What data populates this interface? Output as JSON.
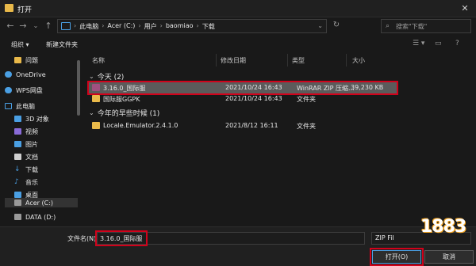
{
  "window": {
    "title": "打开"
  },
  "address": {
    "crumbs": [
      "此电脑",
      "Acer (C:)",
      "用户",
      "baomiao",
      "下载"
    ]
  },
  "search": {
    "placeholder": "搜索\"下载\""
  },
  "command_bar": {
    "organize": "组织 ▾",
    "new_folder": "新建文件夹"
  },
  "sidebar": {
    "items": [
      {
        "label": "问题",
        "icon": "folder-icon",
        "color": "#e9b94a"
      },
      {
        "label": "OneDrive",
        "icon": "cloud-icon",
        "color": "#4a9fe3"
      },
      {
        "label": "WPS网盘",
        "icon": "cloud-icon",
        "color": "#4a9fe3"
      },
      {
        "label": "此电脑",
        "icon": "computer-icon",
        "color": "#4a9fe3"
      },
      {
        "label": "3D 对象",
        "icon": "cube-icon",
        "color": "#4a9fe3"
      },
      {
        "label": "视频",
        "icon": "video-icon",
        "color": "#8a6bd8"
      },
      {
        "label": "图片",
        "icon": "image-icon",
        "color": "#4a9fe3"
      },
      {
        "label": "文档",
        "icon": "document-icon",
        "color": "#d0d0d0"
      },
      {
        "label": "下载",
        "icon": "download-icon",
        "color": "#4a9fe3"
      },
      {
        "label": "音乐",
        "icon": "music-icon",
        "color": "#4a9fe3"
      },
      {
        "label": "桌面",
        "icon": "desktop-icon",
        "color": "#4a9fe3"
      },
      {
        "label": "Acer (C:)",
        "icon": "drive-icon",
        "color": "#9a9a9a"
      },
      {
        "label": "DATA (D:)",
        "icon": "drive-icon",
        "color": "#9a9a9a"
      }
    ]
  },
  "columns": {
    "name": "名称",
    "date": "修改日期",
    "type": "类型",
    "size": "大小"
  },
  "groups": {
    "today": {
      "label": "今天 (2)",
      "files": [
        {
          "name": "3.16.0_国际服",
          "date": "2021/10/24 16:43",
          "type": "WinRAR ZIP 压缩...",
          "size": "39,230 KB",
          "icon": "zip-icon"
        },
        {
          "name": "国际服GGPK",
          "date": "2021/10/24 16:43",
          "type": "文件夹",
          "size": "",
          "icon": "folder-icon"
        }
      ]
    },
    "earlier": {
      "label": "今年的早些时候 (1)",
      "files": [
        {
          "name": "Locale.Emulator.2.4.1.0",
          "date": "2021/8/12 16:11",
          "type": "文件夹",
          "size": "",
          "icon": "folder-icon"
        }
      ]
    }
  },
  "footer": {
    "filename_label": "文件名(N):",
    "filename_value": "3.16.0_国际服",
    "filter": "ZIP Fil",
    "open_label": "打开(O)",
    "cancel_label": "取消"
  },
  "watermark": {
    "text": "1883"
  }
}
